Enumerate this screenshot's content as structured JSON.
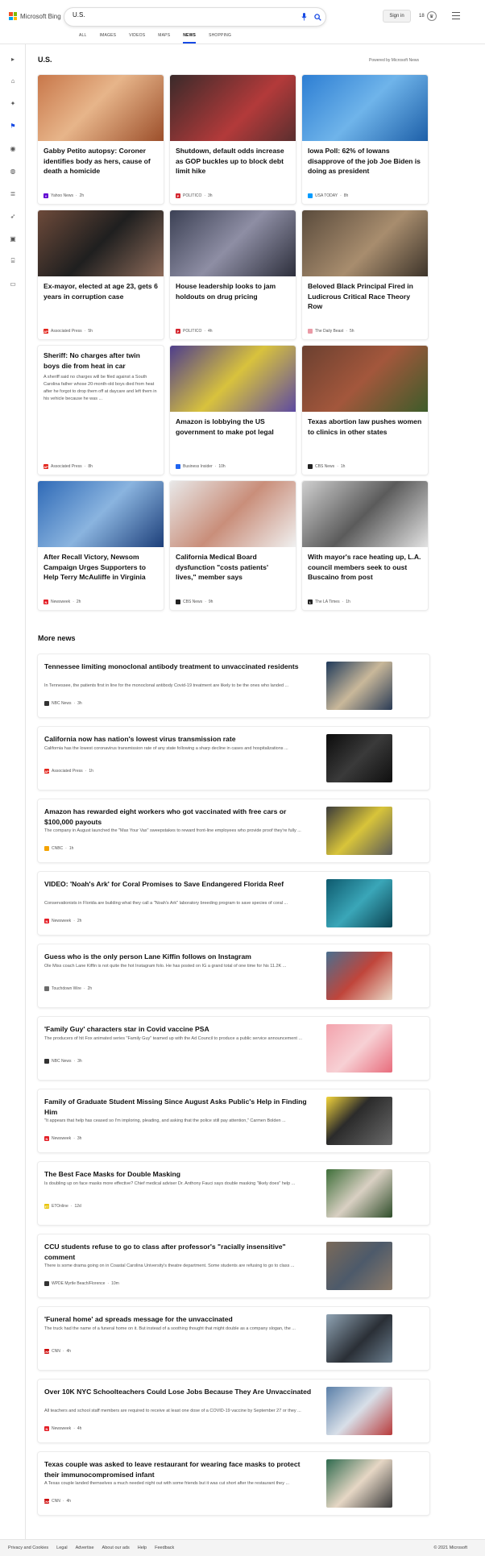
{
  "header": {
    "brand": "Microsoft Bing",
    "search_value": "U.S.",
    "sign_in": "Sign in",
    "rewards_count": "18",
    "tabs": [
      "ALL",
      "IMAGES",
      "VIDEOS",
      "MAPS",
      "NEWS",
      "SHOPPING"
    ],
    "active_tab": "NEWS",
    "accent_color": "#174ae4"
  },
  "section": {
    "title": "U.S.",
    "powered_by": "Powered by Microsoft News"
  },
  "cards": [
    {
      "title": "Gabby Petito autopsy: Coroner identifies body as hers, cause of death a homicide",
      "provider": "Yahoo News",
      "age": "2h",
      "logo_color": "#6001d2",
      "logo_letter": "Y"
    },
    {
      "title": "Shutdown, default odds increase as GOP buckles up to block debt limit hike",
      "provider": "POLITICO",
      "age": "3h",
      "logo_color": "#d4262f",
      "logo_letter": "P"
    },
    {
      "title": "Iowa Poll: 62% of Iowans disapprove of the job Joe Biden is doing as president",
      "provider": "USA TODAY",
      "age": "8h",
      "logo_color": "#009bff",
      "logo_letter": ""
    },
    {
      "title": "Ex-mayor, elected at age 23, gets 6 years in corruption case",
      "provider": "Associated Press",
      "age": "5h",
      "logo_color": "#e2231a",
      "logo_letter": "AP"
    },
    {
      "title": "House leadership looks to jam holdouts on drug pricing",
      "provider": "POLITICO",
      "age": "4h",
      "logo_color": "#d4262f",
      "logo_letter": "P"
    },
    {
      "title": "Beloved Black Principal Fired in Ludicrous Critical Race Theory Row",
      "provider": "The Daily Beast",
      "age": "5h",
      "logo_color": "#ea9aa6",
      "logo_letter": ""
    },
    {
      "title": "Sheriff: No charges after twin boys die from heat in car",
      "snippet": "A sheriff said no charges will be filed against a South Carolina father whose 20-month-old boys died from heat after he forgot to drop them off at daycare and left them in his vehicle because he was ...",
      "provider": "Associated Press",
      "age": "8h",
      "logo_color": "#e2231a",
      "logo_letter": "AP"
    },
    {
      "title": "Amazon is lobbying the US government to make pot legal",
      "provider": "Business Insider",
      "age": "10h",
      "logo_color": "#1f64f0",
      "logo_letter": ""
    },
    {
      "title": "Texas abortion law pushes women to clinics in other states",
      "provider": "CBS News",
      "age": "1h",
      "logo_color": "#222222",
      "logo_letter": ""
    },
    {
      "title": "After Recall Victory, Newsom Campaign Urges Supporters to Help Terry McAuliffe in Virginia",
      "provider": "Newsweek",
      "age": "2h",
      "logo_color": "#e31d25",
      "logo_letter": "N"
    },
    {
      "title": "California Medical Board dysfunction \"costs patients' lives,\" member says",
      "provider": "CBS News",
      "age": "9h",
      "logo_color": "#222222",
      "logo_letter": ""
    },
    {
      "title": "With mayor's race heating up, L.A. council members seek to oust Buscaino from post",
      "provider": "The LA Times",
      "age": "1h",
      "logo_color": "#222222",
      "logo_letter": "L"
    }
  ],
  "more_news": {
    "title": "More news",
    "items": [
      {
        "title": "Tennessee limiting monoclonal antibody treatment to unvaccinated residents",
        "snippet": "In Tennessee, the patients first in line for the monoclonal antibody Covid-19 treatment are likely to be the ones who landed ...",
        "provider": "NBC News",
        "age": "3h",
        "logo_color": "#333333",
        "logo_letter": ""
      },
      {
        "title": "California now has nation's lowest virus transmission rate",
        "snippet": "California has the lowest coronavirus transmission rate of any state following a sharp decline in cases and hospitalizations ...",
        "provider": "Associated Press",
        "age": "1h",
        "logo_color": "#e2231a",
        "logo_letter": "AP"
      },
      {
        "title": "Amazon has rewarded eight workers who got vaccinated with free cars or $100,000 payouts",
        "snippet": "The company in August launched the \"Max Your Vax\" sweepstakes to reward front-line employees who provide proof they're fully ...",
        "provider": "CNBC",
        "age": "1h",
        "logo_color": "#f4a300",
        "logo_letter": ""
      },
      {
        "title": "VIDEO: 'Noah's Ark' for Coral Promises to Save Endangered Florida Reef",
        "snippet": "Conservationists in Florida are building what they call a \"Noah's Ark\" laboratory breeding program to save species of coral ...",
        "provider": "Newsweek",
        "age": "2h",
        "logo_color": "#e31d25",
        "logo_letter": "N"
      },
      {
        "title": "Guess who is the only person Lane Kiffin follows on Instagram",
        "snippet": "Ole Miss coach Lane Kiffin is not quite the hot Instagram folo. He has posted on IG a grand total of one time for his 11.2K ...",
        "provider": "Touchdown Wire",
        "age": "2h",
        "logo_color": "#6b6b6b",
        "logo_letter": ""
      },
      {
        "title": "'Family Guy' characters star in Covid vaccine PSA",
        "snippet": "The producers of hit Fox animated series \"Family Guy\" teamed up with the Ad Council to produce a public service announcement ...",
        "provider": "NBC News",
        "age": "3h",
        "logo_color": "#333333",
        "logo_letter": ""
      },
      {
        "title": "Family of Graduate Student Missing Since August Asks Public's Help in Finding Him",
        "snippet": "\"It appears that help has ceased so I'm imploring, pleading, and asking that the police still pay attention,\" Carmen Bolden ...",
        "provider": "Newsweek",
        "age": "3h",
        "logo_color": "#e31d25",
        "logo_letter": "N"
      },
      {
        "title": "The Best Face Masks for Double Masking",
        "snippet": "Is doubling up on face masks more effective? Chief medical adviser Dr. Anthony Fauci says double masking \"likely does\" help ...",
        "provider": "ETOnline",
        "age": "12d",
        "logo_color": "#e8c300",
        "logo_letter": "ET"
      },
      {
        "title": "CCU students refuse to go to class after professor's \"racially insensitive\" comment",
        "snippet": "There is some drama going on in Coastal Carolina University's theatre department. Some students are refusing to go to class ...",
        "provider": "WPDE Myrtle Beach/Florence",
        "age": "10m",
        "logo_color": "#333333",
        "logo_letter": ""
      },
      {
        "title": "'Funeral home' ad spreads message for the unvaccinated",
        "snippet": "The truck had the name of a funeral home on it. But instead of a soothing thought that might double as a company slogan, the ...",
        "provider": "CNN",
        "age": "4h",
        "logo_color": "#cc0000",
        "logo_letter": "CNN"
      },
      {
        "title": "Over 10K NYC Schoolteachers Could Lose Jobs Because They Are Unvaccinated",
        "snippet": "All teachers and school staff members are required to receive at least one dose of a COVID-19 vaccine by September 27 or they ...",
        "provider": "Newsweek",
        "age": "4h",
        "logo_color": "#e31d25",
        "logo_letter": "N"
      },
      {
        "title": "Texas couple was asked to leave restaurant for wearing face masks to protect their immunocompromised infant",
        "snippet": "A Texas couple landed themselves a much needed night out with some friends but it was cut short after the restaurant they ...",
        "provider": "CNN",
        "age": "4h",
        "logo_color": "#cc0000",
        "logo_letter": "CNN"
      }
    ]
  },
  "footer": {
    "links": [
      "Privacy and Cookies",
      "Legal",
      "Advertise",
      "About our ads",
      "Help",
      "Feedback"
    ],
    "copyright": "© 2021 Microsoft"
  }
}
